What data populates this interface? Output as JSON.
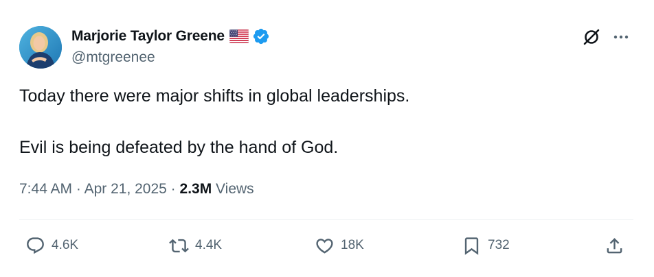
{
  "author": {
    "display_name": "Marjorie Taylor Greene",
    "handle": "@mtgreenee",
    "flag_icon": "us-flag-icon",
    "verified_icon": "verified-badge-icon",
    "verified_color": "#1d9bf0"
  },
  "tweet": {
    "line1": "Today there were major shifts in global leaderships.",
    "line2": "Evil is being defeated by the hand of God."
  },
  "meta": {
    "time": "7:44 AM",
    "separator": " · ",
    "date": "Apr 21, 2025",
    "views_count": "2.3M",
    "views_label": " Views"
  },
  "actions": {
    "reply_count": "4.6K",
    "repost_count": "4.4K",
    "like_count": "18K",
    "bookmark_count": "732"
  },
  "colors": {
    "text_primary": "#0f1419",
    "text_secondary": "#536471",
    "divider": "#eff3f4",
    "verified": "#1d9bf0"
  }
}
